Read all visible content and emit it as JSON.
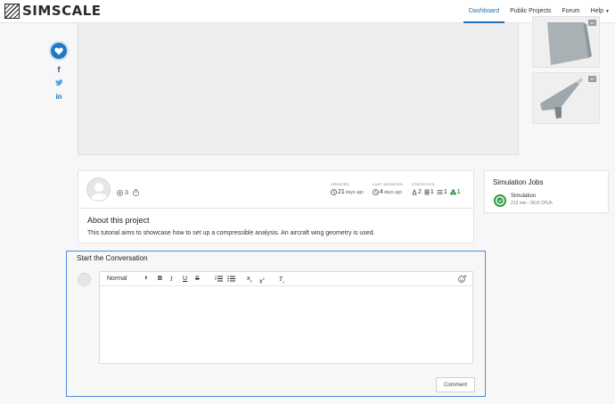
{
  "brand": {
    "name": "SIMSCALE"
  },
  "nav": {
    "items": [
      {
        "label": "Dashboard",
        "active": true
      },
      {
        "label": "Public Projects",
        "active": false
      },
      {
        "label": "Forum",
        "active": false
      },
      {
        "label": "Help",
        "active": false
      }
    ]
  },
  "social": {
    "icons": [
      "heart-icon",
      "facebook-icon",
      "twitter-icon",
      "linkedin-icon"
    ],
    "facebook_glyph": "f",
    "linkedin_glyph": "in"
  },
  "thumbnails": [
    {
      "badge": "3D"
    },
    {
      "badge": "3D"
    }
  ],
  "project": {
    "views": "3",
    "created_label": "CREATED",
    "created_value": "21",
    "created_unit": "days ago",
    "modified_label": "LAST MODIFIED",
    "modified_value": "4",
    "modified_unit": "days ago",
    "statistics_label": "STATISTICS",
    "stats": [
      "2",
      "1",
      "1",
      "1"
    ],
    "about_title": "About this project",
    "about_text": "This tutorial aims to showcase how to set up a compressible analysis. An aircraft wing geometry is used."
  },
  "jobs": {
    "title": "Simulation Jobs",
    "items": [
      {
        "name": "Simulation",
        "meta": "212 min - 56.8 CPUh",
        "status": "success"
      }
    ]
  },
  "conversation": {
    "title": "Start the Conversation",
    "format_select": "Normal",
    "subscript": "x",
    "subscript_mark": "2",
    "superscript": "x",
    "superscript_mark": "2",
    "clear_format": "T",
    "clear_format_mark": "x",
    "comment_button": "Comment"
  },
  "colors": {
    "accent": "#1f6fb2",
    "focus_border": "#4a8fdb",
    "success": "#2e9a3e"
  }
}
